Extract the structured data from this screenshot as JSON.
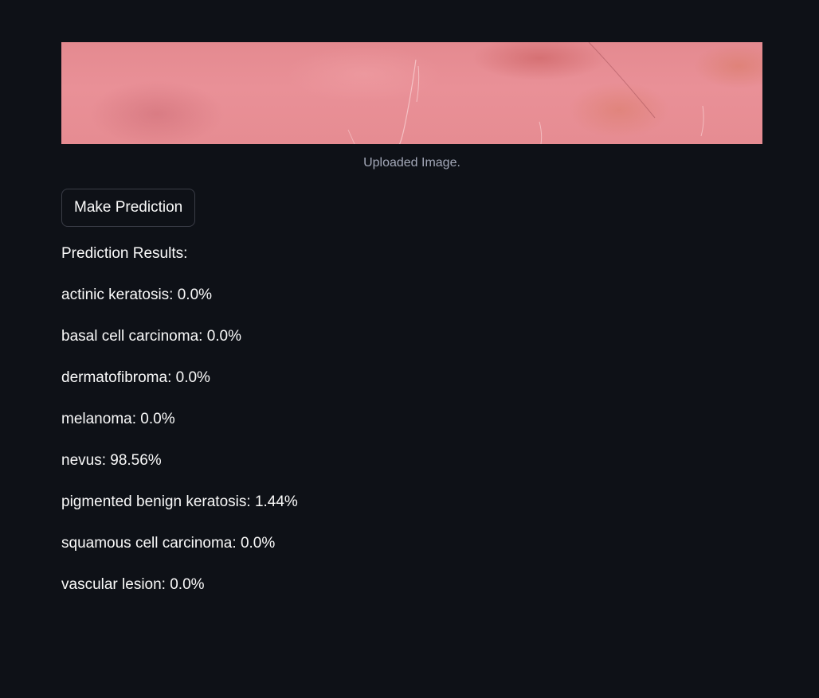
{
  "image": {
    "caption": "Uploaded Image."
  },
  "actions": {
    "predict_label": "Make Prediction"
  },
  "results": {
    "heading": "Prediction Results:",
    "items": [
      {
        "label": "actinic keratosis",
        "value": "0.0%"
      },
      {
        "label": "basal cell carcinoma",
        "value": "0.0%"
      },
      {
        "label": "dermatofibroma",
        "value": "0.0%"
      },
      {
        "label": "melanoma",
        "value": "0.0%"
      },
      {
        "label": "nevus",
        "value": "98.56%"
      },
      {
        "label": "pigmented benign keratosis",
        "value": "1.44%"
      },
      {
        "label": "squamous cell carcinoma",
        "value": "0.0%"
      },
      {
        "label": "vascular lesion",
        "value": "0.0%"
      }
    ]
  },
  "colors": {
    "background": "#0e1117",
    "text": "#fafafa",
    "caption": "#a3a8b8",
    "button_border": "#3a3d47"
  }
}
